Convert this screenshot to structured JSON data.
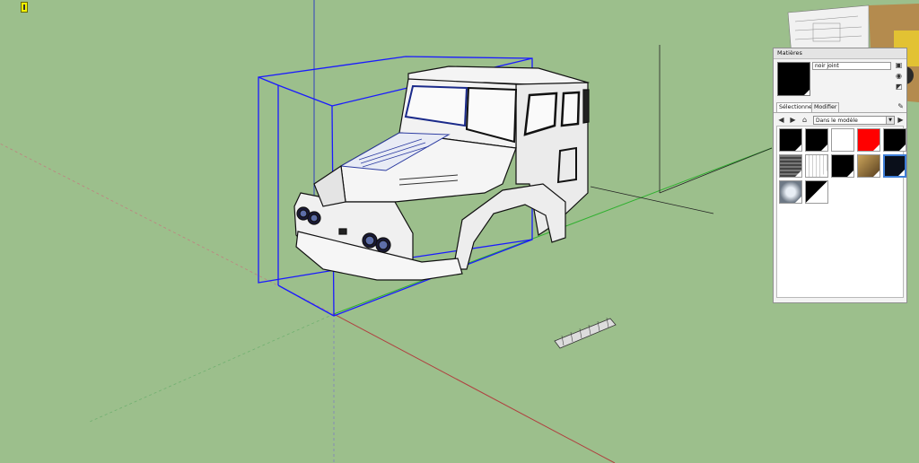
{
  "panel": {
    "title": "Matières",
    "material_name": "noir joint",
    "tabs": {
      "select": "Sélectionner",
      "edit": "Modifier"
    },
    "collection": "Dans le modèle"
  },
  "materials": [
    {
      "name": "black",
      "color": "#000000"
    },
    {
      "name": "black",
      "color": "#000000"
    },
    {
      "name": "white",
      "color": "#ffffff"
    },
    {
      "name": "red",
      "color": "#ff0000"
    },
    {
      "name": "black",
      "color": "#000000"
    },
    {
      "name": "grey-texture",
      "color": "#555555"
    },
    {
      "name": "blueprint-texture",
      "color": "#e6e6e6"
    },
    {
      "name": "black",
      "color": "#000000"
    },
    {
      "name": "photo-texture",
      "color": "#8a6a3a"
    },
    {
      "name": "dark-blue-black",
      "color": "#0a0f1a"
    },
    {
      "name": "chrome-texture",
      "color": "#a8b0b8"
    },
    {
      "name": "black-white",
      "color": "#000000"
    }
  ],
  "colors": {
    "viewport_bg": "#9cbf8c",
    "selection_box": "#1a1aff",
    "axis_red": "#b03030",
    "axis_green": "#2faa2f",
    "axis_blue": "#3040c0"
  }
}
